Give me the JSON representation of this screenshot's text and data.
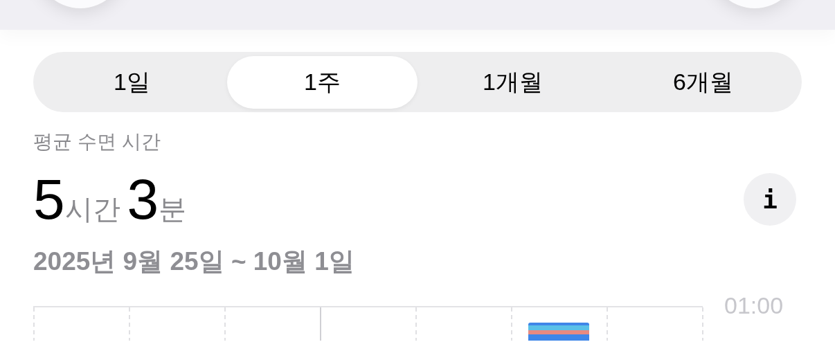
{
  "header": {
    "buttons": [
      {
        "kind": "round"
      },
      {
        "kind": "round"
      }
    ]
  },
  "tabs": [
    {
      "label": "1일",
      "selected": false
    },
    {
      "label": "1주",
      "selected": true
    },
    {
      "label": "1개월",
      "selected": false
    },
    {
      "label": "6개월",
      "selected": false
    }
  ],
  "summary": {
    "title": "평균 수면 시간",
    "hours": "5",
    "hours_unit": "시간",
    "minutes": "3",
    "minutes_unit": "분",
    "date_range": "2025년 9월 25일 ~ 10월 1일"
  },
  "info_button": {
    "label": "i"
  },
  "chart": {
    "axis_label": "01:00"
  }
}
